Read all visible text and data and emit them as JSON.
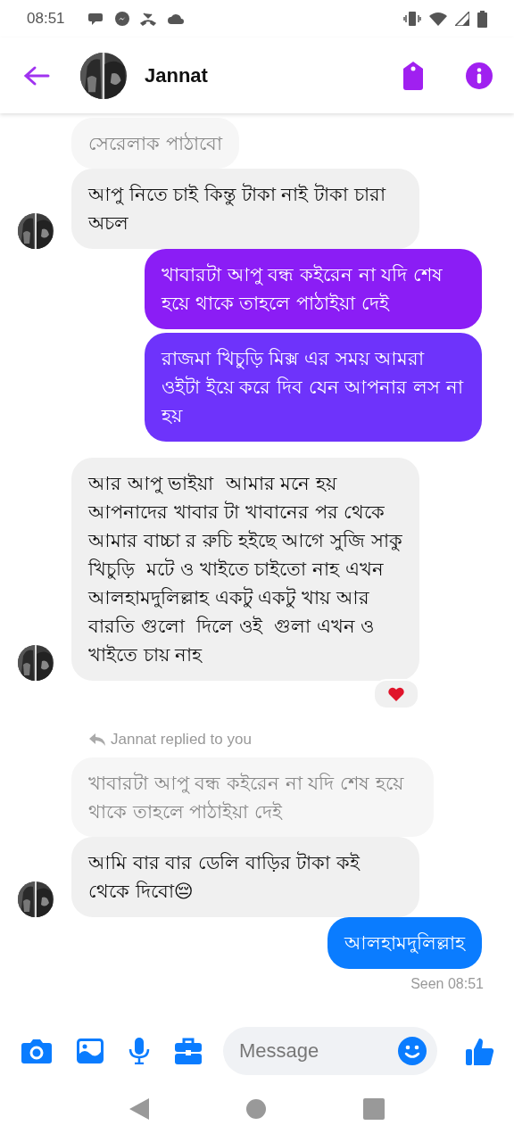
{
  "status_bar": {
    "time": "08:51"
  },
  "header": {
    "name": "Jannat"
  },
  "messages": [
    {
      "kind": "quote",
      "text": "সেরেলাক পাঠাবো"
    },
    {
      "kind": "incoming",
      "text": "আপু নিতে চাই কিন্তু টাকা নাই টাকা চারা অচল",
      "avatar": true
    },
    {
      "kind": "outgoing",
      "text": "খাবারটা আপু বন্ধ কইরেন না যদি শেষ হয়ে থাকে তাহলে পাঠাইয়া দেই",
      "color": "#8b1df5"
    },
    {
      "kind": "outgoing",
      "text": "রাজমা খিচুড়ি মিক্স এর সময় আমরা ওইটা ইয়ে করে দিব যেন আপনার লস না হয়",
      "color": "#6e33fb"
    },
    {
      "kind": "incoming",
      "text": "আর আপু ভাইয়া  আমার মনে হয় আপনাদের খাবার টা খাবানের পর থেকে আমার বাচ্চা র রুচি হইছে আগে সুজি সাকু খিচুড়ি  মটে ও খাইতে চাইতো নাহ এখন আলহামদুলিল্লাহ একটু একটু খায় আর বারতি গুলো  দিলে ওই  গুলা এখন ও খাইতে চায় নাহ",
      "avatar": true,
      "heart_reaction": true
    },
    {
      "kind": "reply_note",
      "text": "Jannat replied to you"
    },
    {
      "kind": "quote",
      "text": "খাবারটা আপু বন্ধ কইরেন না যদি শেষ হয়ে থাকে তাহলে পাঠাইয়া দেই"
    },
    {
      "kind": "incoming",
      "text": "আমি বার বার ডেলি বাড়ির টাকা কই থেকে দিবো😔",
      "avatar": true
    },
    {
      "kind": "outgoing",
      "text": "আলহামদুলিল্লাহ",
      "color": "#0a7cff"
    }
  ],
  "seen": "Seen 08:51",
  "composer": {
    "placeholder": "Message"
  }
}
